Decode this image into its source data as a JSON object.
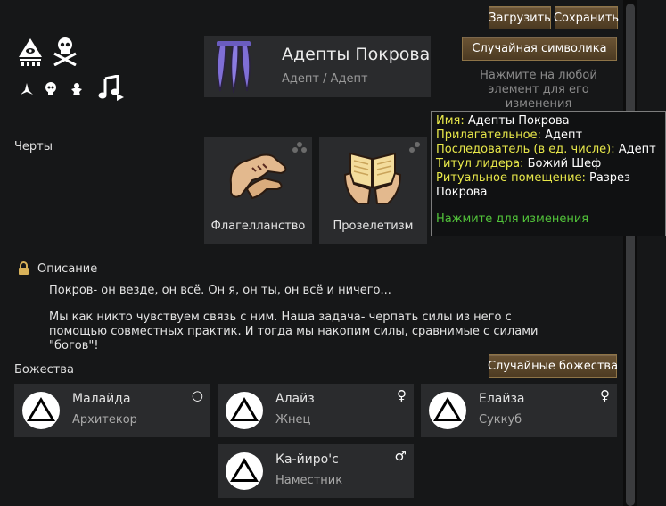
{
  "header": {
    "load_label": "Загрузить",
    "save_label": "Сохранить",
    "random_symbols_label": "Случайная символика",
    "edit_hint": "Нажмите на любой элемент для его изменения"
  },
  "ideo": {
    "name": "Адепты Покрова",
    "subtitle": "Адепт / Адепт"
  },
  "memes": {
    "section_label": "Черты",
    "items": [
      {
        "label": "Флагелланство",
        "icon": "flagellation-hands-icon"
      },
      {
        "label": "Прозелетизм",
        "icon": "book-hands-icon"
      }
    ]
  },
  "tooltip": {
    "rows": [
      {
        "key": "Имя:",
        "value": "Адепты Покрова"
      },
      {
        "key": "Прилагательное:",
        "value": "Адепт"
      },
      {
        "key": "Последователь (в ед. числе):",
        "value": "Адепт"
      },
      {
        "key": "Титул лидера:",
        "value": "Божий Шеф"
      },
      {
        "key": "Ритуальное помещение:",
        "value": "Разрез Покрова"
      }
    ],
    "hint": "Нажмите для изменения"
  },
  "description": {
    "label": "Описание",
    "paragraph1": "Покров- он везде, он всё. Он я, он ты, он всё и ничего...",
    "paragraph2": "Мы как никто чувствуем связь с ним. Наша задача- черпать силы из него с помощью совместных практик. И тогда мы накопим силы, сравнимые с силами \"богов\"!"
  },
  "deities": {
    "section_label": "Божества",
    "random_label": "Случайные божества",
    "items": [
      {
        "name": "Малайда",
        "title": "Архитекор",
        "gender": "○"
      },
      {
        "name": "Алайз",
        "title": "Жнец",
        "gender": "♀"
      },
      {
        "name": "Елайза",
        "title": "Суккуб",
        "gender": "♀"
      },
      {
        "name": "Ка-йиро'с",
        "title": "Наместник",
        "gender": "♂"
      }
    ]
  },
  "colors": {
    "background": "#161718",
    "panel": "#2a2b2d",
    "button": "#5c4a2f",
    "tooltip_key": "#e8e84a",
    "tooltip_hint": "#52c33a",
    "ideo_icon": "#7f6fd6"
  }
}
